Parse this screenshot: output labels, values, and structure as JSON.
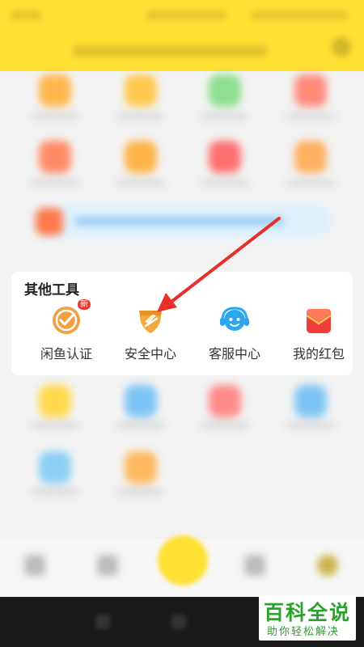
{
  "section": {
    "title": "其他工具",
    "items": [
      {
        "label": "闲鱼认证",
        "icon": "verification-icon",
        "badge": "新"
      },
      {
        "label": "安全中心",
        "icon": "shield-icon"
      },
      {
        "label": "客服中心",
        "icon": "customer-service-icon"
      },
      {
        "label": "我的红包",
        "icon": "red-envelope-icon"
      }
    ]
  },
  "colors": {
    "header": "#ffe033",
    "arrow": "#e8302a",
    "badge": "#e8382f"
  },
  "watermark": {
    "main": "百科全说",
    "sub": "助你轻松解决"
  }
}
